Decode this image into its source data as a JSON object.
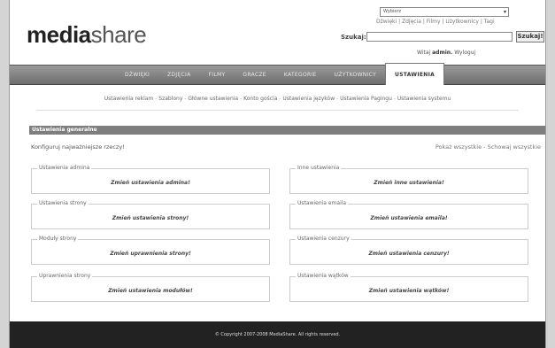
{
  "header": {
    "logo_bold": "media",
    "logo_rest": "share",
    "filter_select_value": "Wybierz",
    "filter_links": "Dźwięki | Zdjęcia | Filmy | Użytkownicy | Tagi",
    "search_label": "Szukaj:",
    "search_value": "",
    "search_button": "Szukaj!",
    "welcome_prefix": "Witaj",
    "welcome_user": "admin.",
    "welcome_logout": "Wyloguj"
  },
  "nav": {
    "items": [
      {
        "label": "DŹWIĘKI"
      },
      {
        "label": "ZDJĘCIA"
      },
      {
        "label": "FILMY"
      },
      {
        "label": "GRACZE"
      },
      {
        "label": "KATEGORIE"
      },
      {
        "label": "UŻYTKOWNICY"
      },
      {
        "label": "USTAWIENIA"
      }
    ]
  },
  "sub_links": [
    {
      "label": "Ustawienia reklam"
    },
    {
      "label": "Szablony"
    },
    {
      "label": "Główne ustawienia"
    },
    {
      "label": "Konto gościa"
    },
    {
      "label": "Ustawienia języków"
    },
    {
      "label": "Ustawienia Pagingu"
    },
    {
      "label": "Ustawienia systemu"
    }
  ],
  "panel": {
    "title": "Ustawienia generalne",
    "configure_text": "Konfiguruj najważniejsze rzeczy!",
    "show_all": "Pokaż wszystkie",
    "hide_all": "Schowaj wszystkie",
    "boxes": [
      {
        "legend": "Ustawienia admina",
        "link": "Zmień ustawienia admina!"
      },
      {
        "legend": "Inne ustawienia",
        "link": "Zmień inne ustawienia!"
      },
      {
        "legend": "Ustawienia strony",
        "link": "Zmień ustawienia strony!"
      },
      {
        "legend": "Ustawienia emaila",
        "link": "Zmień ustawienia emaila!"
      },
      {
        "legend": "Moduły strony",
        "link": "Zmień uprawnienia strony!"
      },
      {
        "legend": "Ustawienia cenzury",
        "link": "Zmień ustawienia cenzury!"
      },
      {
        "legend": "Uprawnienia strony",
        "link": "Zmień ustawienia modułów!"
      },
      {
        "legend": "Ustawienia wątków",
        "link": "Zmień ustawienia wątków!"
      }
    ]
  },
  "footer": {
    "copyright": "© Copyright 2007-2008 MediaShare. All rights reserved."
  },
  "colors": {
    "nav_bar": "#7f7f7f",
    "panel_title_bg": "#7e7e7e",
    "footer_bg": "#222222"
  }
}
